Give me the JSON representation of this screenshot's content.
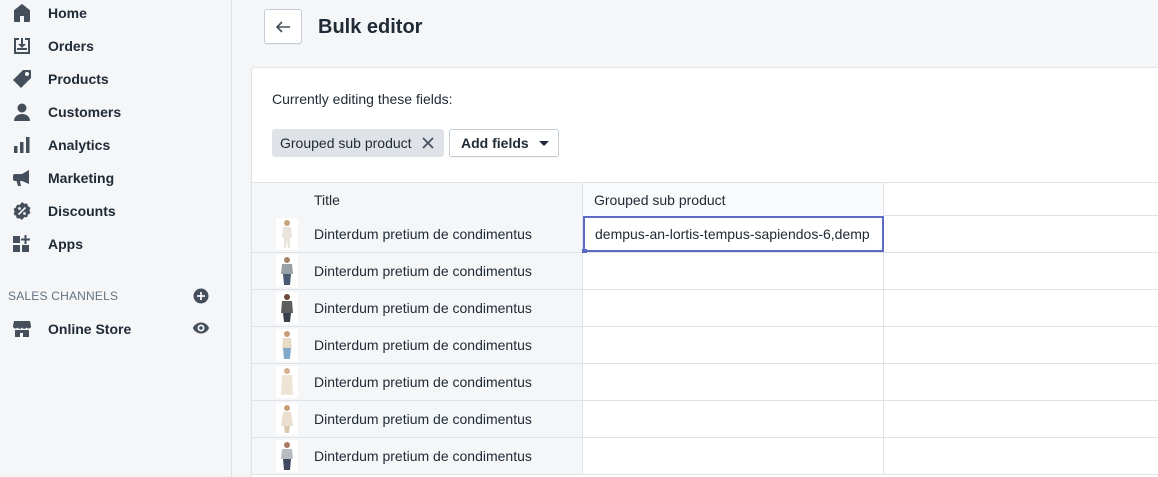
{
  "sidebar": {
    "items": [
      {
        "label": "Home",
        "icon": "home-icon"
      },
      {
        "label": "Orders",
        "icon": "orders-icon"
      },
      {
        "label": "Products",
        "icon": "tag-icon"
      },
      {
        "label": "Customers",
        "icon": "person-icon"
      },
      {
        "label": "Analytics",
        "icon": "bar-chart-icon"
      },
      {
        "label": "Marketing",
        "icon": "megaphone-icon"
      },
      {
        "label": "Discounts",
        "icon": "discount-icon"
      },
      {
        "label": "Apps",
        "icon": "apps-icon"
      }
    ],
    "sales_channels_label": "SALES CHANNELS",
    "channels": [
      {
        "label": "Online Store",
        "icon": "store-icon"
      }
    ]
  },
  "header": {
    "title": "Bulk editor"
  },
  "editor": {
    "editing_label": "Currently editing these fields:",
    "field_tag": "Grouped sub product",
    "add_fields_label": "Add fields"
  },
  "grid": {
    "columns": [
      "Title",
      "Grouped sub product"
    ],
    "rows": [
      {
        "title": "Dinterdum pretium de condimentus",
        "grouped_sub_product": "dempus-an-lortis-tempus-sapiendos-6,demp"
      },
      {
        "title": "Dinterdum pretium de condimentus",
        "grouped_sub_product": ""
      },
      {
        "title": "Dinterdum pretium de condimentus",
        "grouped_sub_product": ""
      },
      {
        "title": "Dinterdum pretium de condimentus",
        "grouped_sub_product": ""
      },
      {
        "title": "Dinterdum pretium de condimentus",
        "grouped_sub_product": ""
      },
      {
        "title": "Dinterdum pretium de condimentus",
        "grouped_sub_product": ""
      },
      {
        "title": "Dinterdum pretium de condimentus",
        "grouped_sub_product": ""
      }
    ]
  },
  "colors": {
    "icon": "#454f5b",
    "selection": "#5c6ac4",
    "text": "#212b36"
  }
}
